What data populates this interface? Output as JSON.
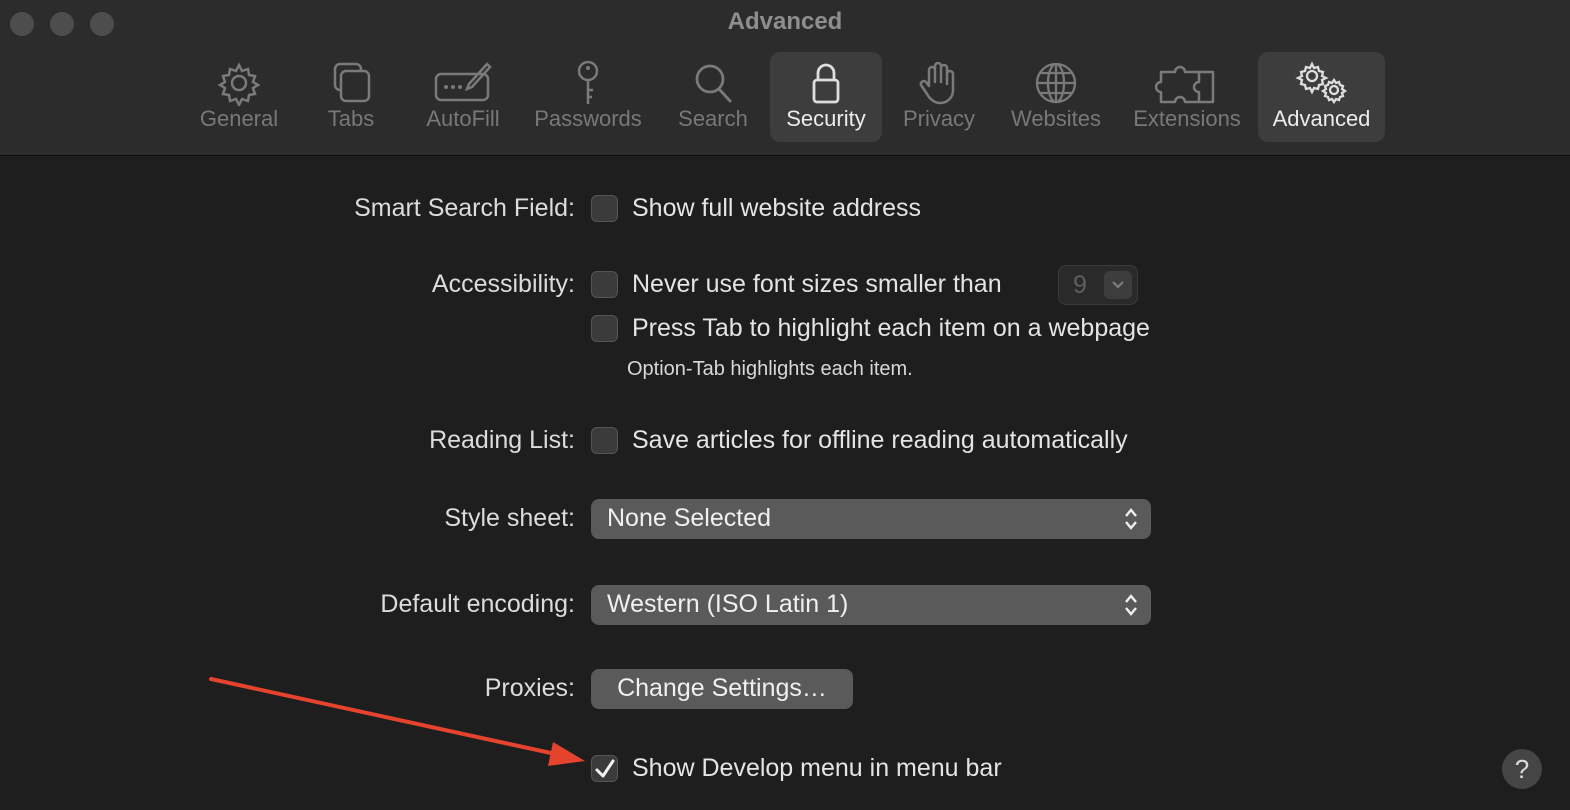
{
  "window": {
    "title": "Advanced"
  },
  "toolbar": {
    "tabs": [
      {
        "label": "General",
        "icon": "gear-icon"
      },
      {
        "label": "Tabs",
        "icon": "tabs-icon"
      },
      {
        "label": "AutoFill",
        "icon": "autofill-pencil-icon"
      },
      {
        "label": "Passwords",
        "icon": "key-icon"
      },
      {
        "label": "Search",
        "icon": "magnifier-icon"
      },
      {
        "label": "Security",
        "icon": "lock-icon"
      },
      {
        "label": "Privacy",
        "icon": "hand-icon"
      },
      {
        "label": "Websites",
        "icon": "globe-icon"
      },
      {
        "label": "Extensions",
        "icon": "puzzle-icon"
      },
      {
        "label": "Advanced",
        "icon": "gears-icon"
      }
    ]
  },
  "settings": {
    "smart_search": {
      "label": "Smart Search Field:",
      "option": "Show full website address",
      "checked": false
    },
    "accessibility": {
      "label": "Accessibility:",
      "font_option": "Never use font sizes smaller than",
      "font_size_value": "9",
      "font_checked": false,
      "tab_option": "Press Tab to highlight each item on a webpage",
      "tab_checked": false,
      "note": "Option-Tab highlights each item."
    },
    "reading_list": {
      "label": "Reading List:",
      "option": "Save articles for offline reading automatically",
      "checked": false
    },
    "style_sheet": {
      "label": "Style sheet:",
      "value": "None Selected"
    },
    "encoding": {
      "label": "Default encoding:",
      "value": "Western (ISO Latin 1)"
    },
    "proxies": {
      "label": "Proxies:",
      "button": "Change Settings…"
    },
    "develop": {
      "option": "Show Develop menu in menu bar",
      "checked": true
    }
  },
  "help": {
    "label": "?"
  },
  "colors": {
    "background": "#1e1e1e",
    "toolbar": "#2c2c2c",
    "annotation_arrow": "#e5432d"
  }
}
